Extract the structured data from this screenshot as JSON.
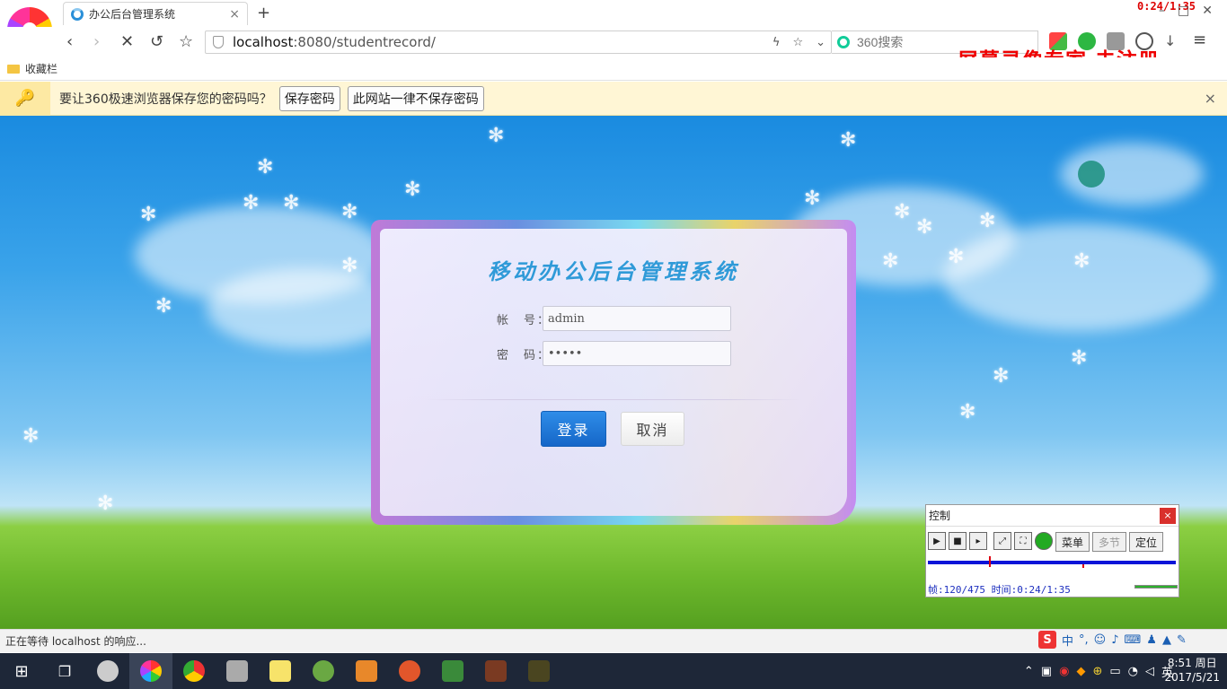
{
  "browser": {
    "tab_title": "办公后台管理系统",
    "tab_close": "×",
    "new_tab": "+",
    "recorder_time": "0:24/1:35",
    "url_host": "localhost",
    "url_path": ":8080/studentrecord/",
    "search_placeholder": "360搜索",
    "watermark": "屏幕录像专家 未注册",
    "bookmarks_label": "收藏栏",
    "status_text": "正在等待 localhost 的响应..."
  },
  "password_bar": {
    "message": "要让360极速浏览器保存您的密码吗？",
    "save_button": "保存密码",
    "never_button": "此网站一律不保存密码",
    "close": "×"
  },
  "login": {
    "title": "移动办公后台管理系统",
    "account_label": "帐　号：",
    "account_value": "admin",
    "password_label": "密　码：",
    "password_value": "•••••",
    "login_button": "登录",
    "cancel_button": "取消"
  },
  "recorder": {
    "window_title": "控制",
    "close": "×",
    "menu_button": "菜单",
    "multi_button": "多节",
    "locate_button": "定位",
    "info": "帧:120/475 时间:0:24/1:35"
  },
  "ime": {
    "mode": "中"
  },
  "taskbar": {
    "time": "8:51 周日",
    "date": "2017/5/21",
    "lang": "英"
  },
  "colors": {
    "title_blue": "#2f9ad8",
    "login_button": "#1566c8",
    "watermark_red": "#e00000"
  }
}
